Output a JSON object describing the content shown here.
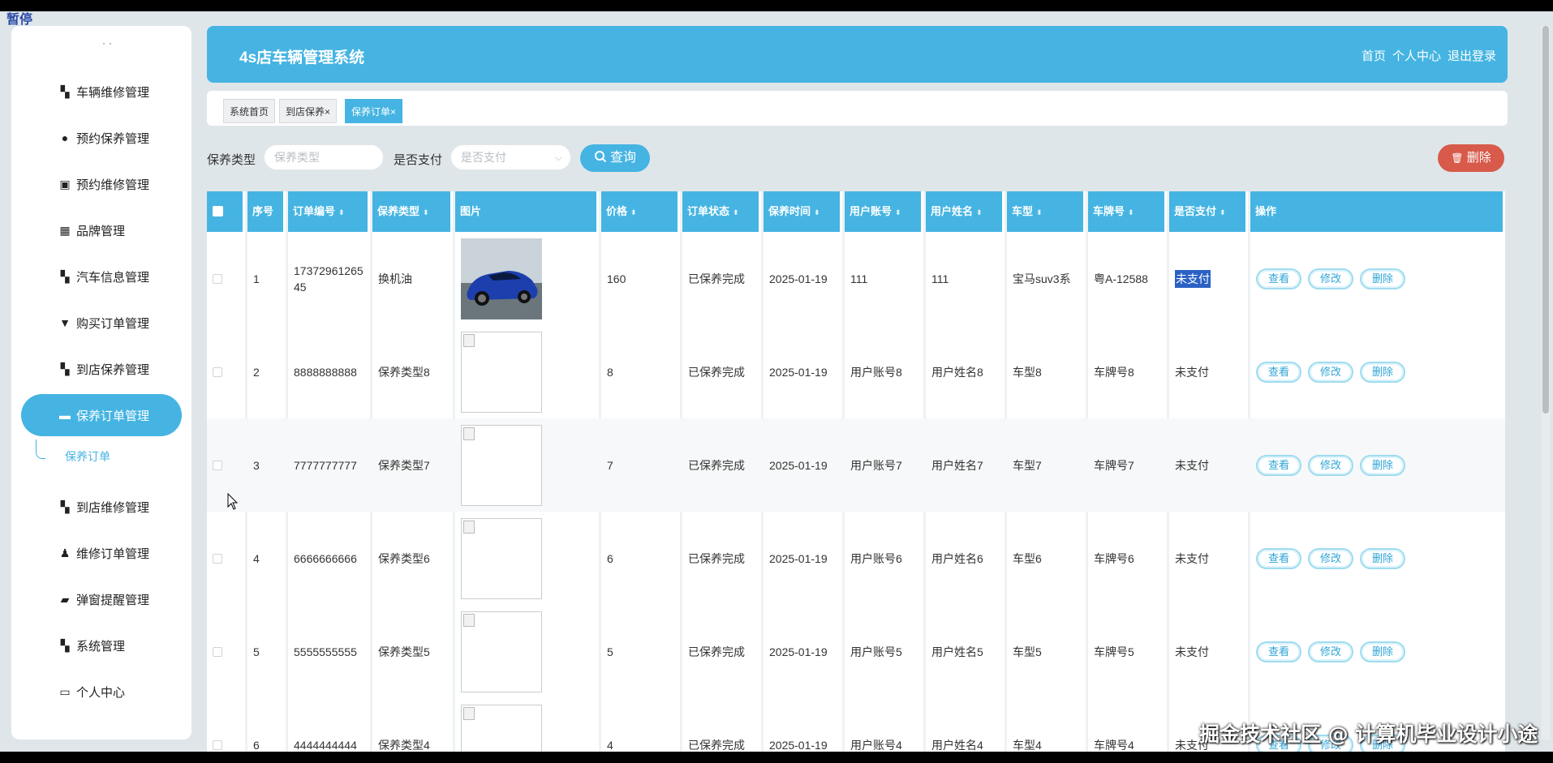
{
  "pause_label": "暂停",
  "header": {
    "title": "4s店车辆管理系统",
    "nav": [
      "首页",
      "个人中心",
      "退出登录"
    ]
  },
  "sidebar": {
    "items": [
      {
        "label": "车辆维修管理",
        "icon": "grid-icon"
      },
      {
        "label": "预约保养管理",
        "icon": "pin-icon"
      },
      {
        "label": "预约维修管理",
        "icon": "calendar-icon"
      },
      {
        "label": "品牌管理",
        "icon": "apps-icon"
      },
      {
        "label": "汽车信息管理",
        "icon": "grid-icon"
      },
      {
        "label": "购买订单管理",
        "icon": "cup-icon"
      },
      {
        "label": "到店保养管理",
        "icon": "grid-icon"
      },
      {
        "label": "保养订单管理",
        "icon": "file-icon",
        "active": true
      },
      {
        "label": "到店维修管理",
        "icon": "grid-icon"
      },
      {
        "label": "维修订单管理",
        "icon": "user-icon"
      },
      {
        "label": "弹窗提醒管理",
        "icon": "message-icon"
      },
      {
        "label": "系统管理",
        "icon": "grid-icon"
      },
      {
        "label": "个人中心",
        "icon": "card-icon"
      }
    ],
    "sub_item": "保养订单"
  },
  "tabs": [
    {
      "label": "系统首页",
      "closable": false
    },
    {
      "label": "到店保养",
      "closable": true
    },
    {
      "label": "保养订单",
      "closable": true,
      "active": true
    }
  ],
  "search": {
    "type_label": "保养类型",
    "type_placeholder": "保养类型",
    "paid_label": "是否支付",
    "paid_placeholder": "是否支付",
    "query_button": "查询",
    "delete_button": "删除"
  },
  "table": {
    "headers": [
      "序号",
      "订单编号",
      "保养类型",
      "图片",
      "价格",
      "订单状态",
      "保养时间",
      "用户账号",
      "用户姓名",
      "车型",
      "车牌号",
      "是否支付",
      "操作"
    ],
    "rows": [
      {
        "idx": "1",
        "order_no": "1737296126545",
        "type": "换机油",
        "price": "160",
        "status": "已保养完成",
        "time": "2025-01-19",
        "account": "111",
        "name": "111",
        "model": "宝马suv3系",
        "plate": "粤A-12588",
        "paid": "未支付",
        "has_photo": true
      },
      {
        "idx": "2",
        "order_no": "8888888888",
        "type": "保养类型8",
        "price": "8",
        "status": "已保养完成",
        "time": "2025-01-19",
        "account": "用户账号8",
        "name": "用户姓名8",
        "model": "车型8",
        "plate": "车牌号8",
        "paid": "未支付"
      },
      {
        "idx": "3",
        "order_no": "7777777777",
        "type": "保养类型7",
        "price": "7",
        "status": "已保养完成",
        "time": "2025-01-19",
        "account": "用户账号7",
        "name": "用户姓名7",
        "model": "车型7",
        "plate": "车牌号7",
        "paid": "未支付"
      },
      {
        "idx": "4",
        "order_no": "6666666666",
        "type": "保养类型6",
        "price": "6",
        "status": "已保养完成",
        "time": "2025-01-19",
        "account": "用户账号6",
        "name": "用户姓名6",
        "model": "车型6",
        "plate": "车牌号6",
        "paid": "未支付"
      },
      {
        "idx": "5",
        "order_no": "5555555555",
        "type": "保养类型5",
        "price": "5",
        "status": "已保养完成",
        "time": "2025-01-19",
        "account": "用户账号5",
        "name": "用户姓名5",
        "model": "车型5",
        "plate": "车牌号5",
        "paid": "未支付"
      },
      {
        "idx": "6",
        "order_no": "4444444444",
        "type": "保养类型4",
        "price": "4",
        "status": "已保养完成",
        "time": "2025-01-19",
        "account": "用户账号4",
        "name": "用户姓名4",
        "model": "车型4",
        "plate": "车牌号4",
        "paid": "未支付"
      }
    ],
    "actions": [
      "查看",
      "修改",
      "删除"
    ]
  },
  "watermark": "掘金技术社区 @ 计算机毕业设计小途",
  "colors": {
    "accent": "#45b4e2",
    "danger": "#d85a4a",
    "selection": "#2b61c4"
  }
}
